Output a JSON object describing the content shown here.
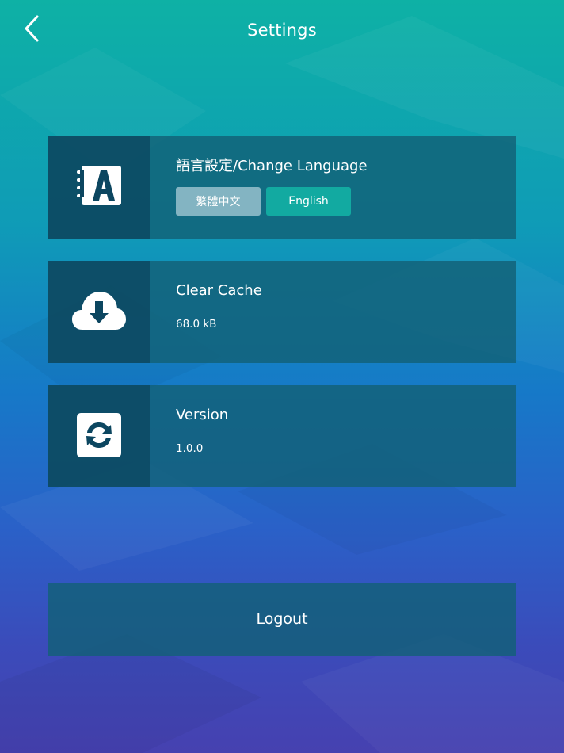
{
  "header": {
    "title": "Settings",
    "back_icon": "chevron-left-icon"
  },
  "language": {
    "title": "語言設定/Change Language",
    "icon": "language-book-icon",
    "options": [
      "繁體中文",
      "English"
    ],
    "selected": "English"
  },
  "cache": {
    "title": "Clear Cache",
    "value": "68.0 kB",
    "icon": "cloud-download-icon"
  },
  "version": {
    "title": "Version",
    "value": "1.0.0",
    "icon": "refresh-icon"
  },
  "logout": {
    "label": "Logout"
  },
  "colors": {
    "card_bg": "#126076",
    "icon_cell_bg": "#0c4660",
    "selected_button": "#12aaa1",
    "unselected_button": "#83b4c2",
    "gradient_top": "#0eb1a5",
    "gradient_bottom": "#4641b0"
  }
}
